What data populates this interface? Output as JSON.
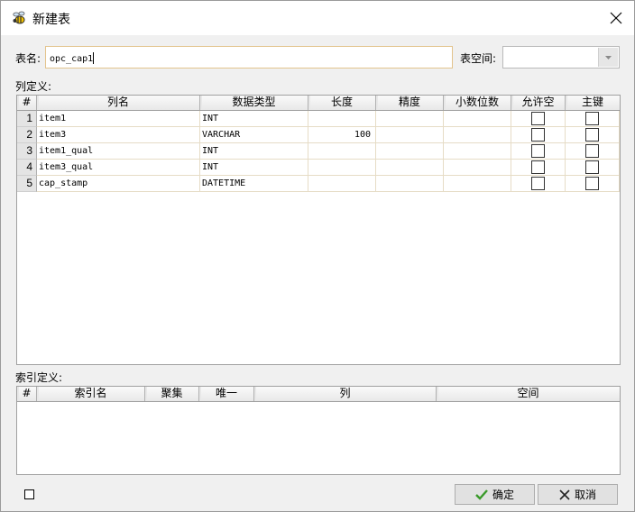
{
  "window": {
    "title": "新建表"
  },
  "form": {
    "table_name_label": "表名:",
    "table_name_value": "opc_cap1",
    "tablespace_label": "表空间:",
    "tablespace_value": ""
  },
  "columns_section": {
    "label": "列定义:",
    "headers": [
      "#",
      "列名",
      "数据类型",
      "长度",
      "精度",
      "小数位数",
      "允许空",
      "主键"
    ],
    "rows": [
      {
        "num": "1",
        "name": "item1",
        "type": "INT",
        "length": "",
        "precision": "",
        "scale": "",
        "nullable": false,
        "pk": false
      },
      {
        "num": "2",
        "name": "item3",
        "type": "VARCHAR",
        "length": "100",
        "precision": "",
        "scale": "",
        "nullable": false,
        "pk": false
      },
      {
        "num": "3",
        "name": "item1_qual",
        "type": "INT",
        "length": "",
        "precision": "",
        "scale": "",
        "nullable": false,
        "pk": false
      },
      {
        "num": "4",
        "name": "item3_qual",
        "type": "INT",
        "length": "",
        "precision": "",
        "scale": "",
        "nullable": false,
        "pk": false
      },
      {
        "num": "5",
        "name": "cap_stamp",
        "type": "DATETIME",
        "length": "",
        "precision": "",
        "scale": "",
        "nullable": false,
        "pk": false
      }
    ]
  },
  "index_section": {
    "label": "索引定义:",
    "headers": [
      "#",
      "索引名",
      "聚集",
      "唯一",
      "列",
      "空间"
    ]
  },
  "buttons": {
    "ok": "确定",
    "cancel": "取消"
  },
  "colors": {
    "ok_check": "#3a9a2a",
    "input_border": "#e3c48d"
  }
}
